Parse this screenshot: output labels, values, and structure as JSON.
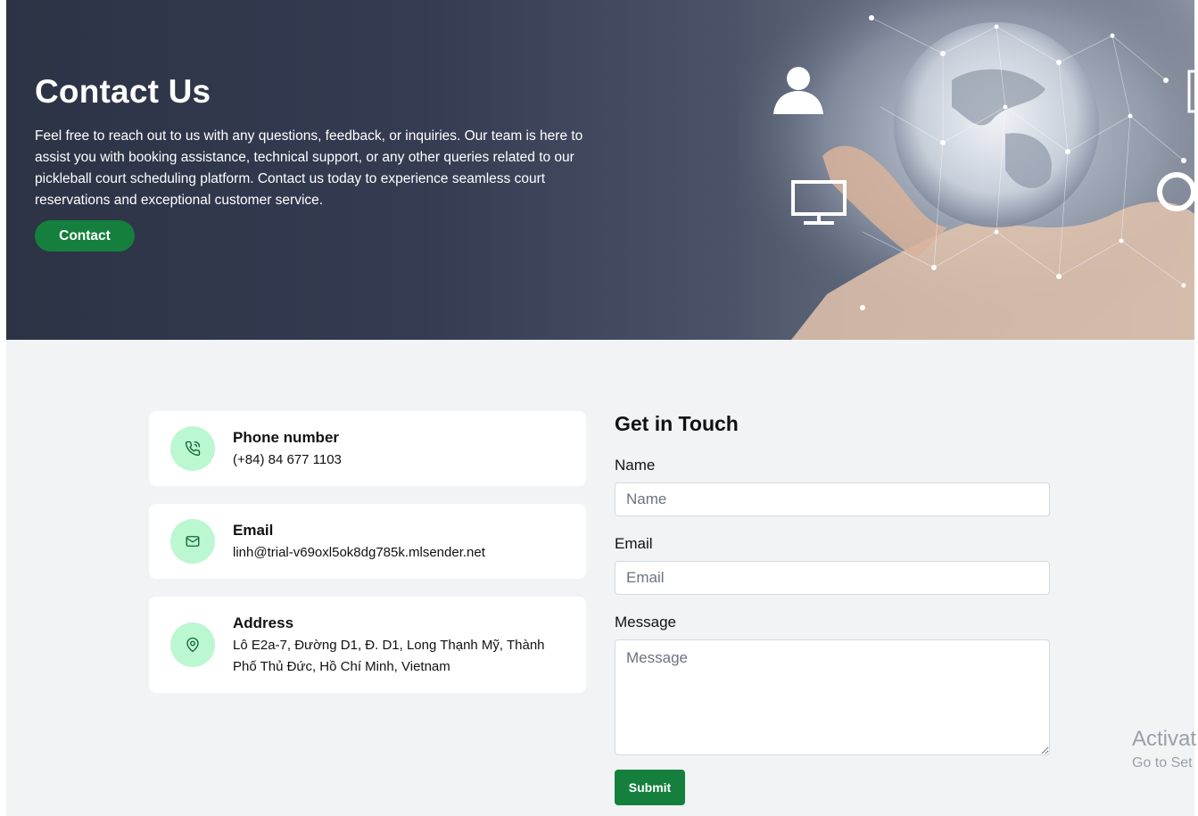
{
  "hero": {
    "title": "Contact Us",
    "description": "Feel free to reach out to us with any questions, feedback, or inquiries. Our team is here to assist you with booking assistance, technical support, or any other queries related to our pickleball court scheduling platform. Contact us today to experience seamless court reservations and exceptional customer service.",
    "button_label": "Contact",
    "image_icon": "globe-in-hand-network-image"
  },
  "contact_cards": [
    {
      "title": "Phone number",
      "value": "(+84) 84 677 1103",
      "icon": "phone-icon"
    },
    {
      "title": "Email",
      "value": "linh@trial-v69oxl5ok8dg785k.mlsender.net",
      "icon": "mail-icon"
    },
    {
      "title": "Address",
      "value": "Lô E2a-7, Đường D1, Đ. D1, Long Thạnh Mỹ, Thành Phố Thủ Đức, Hồ Chí Minh, Vietnam",
      "icon": "location-pin-icon"
    }
  ],
  "form": {
    "title": "Get in Touch",
    "name_label": "Name",
    "name_placeholder": "Name",
    "email_label": "Email",
    "email_placeholder": "Email",
    "message_label": "Message",
    "message_placeholder": "Message",
    "submit_label": "Submit"
  },
  "watermark": {
    "line1": "Activat",
    "line2": "Go to Set"
  },
  "colors": {
    "accent_green": "#15803d",
    "icon_bg": "#bbf7d0",
    "hero_bg": "#2c3345",
    "page_bg": "#f2f3f5"
  }
}
